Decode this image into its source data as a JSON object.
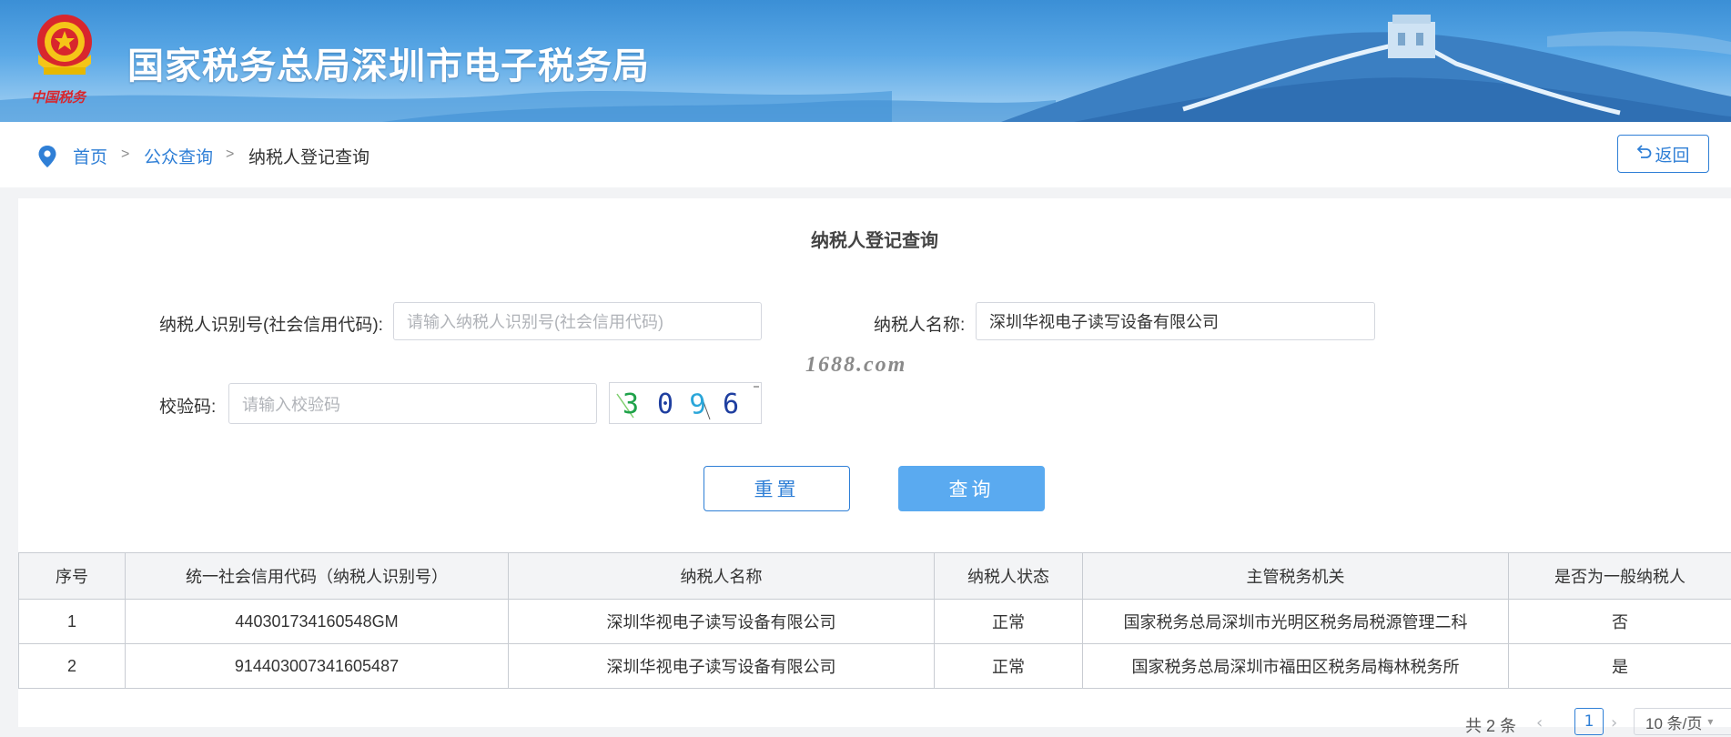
{
  "header": {
    "title": "国家税务总局深圳市电子税务局",
    "emblem_caption": "中国税务"
  },
  "breadcrumb": {
    "items": [
      "首页",
      "公众查询",
      "纳税人登记查询"
    ],
    "separator": ">"
  },
  "back_button": {
    "icon": "return-icon",
    "label": "返回"
  },
  "form": {
    "title": "纳税人登记查询",
    "taxpayer_id": {
      "label": "纳税人识别号(社会信用代码):",
      "placeholder": "请输入纳税人识别号(社会信用代码)",
      "value": ""
    },
    "taxpayer_name": {
      "label": "纳税人名称:",
      "value": "深圳华视电子读写设备有限公司"
    },
    "captcha": {
      "label": "校验码:",
      "placeholder": "请输入校验码",
      "value": "",
      "image_text": "3096"
    },
    "reset_label": "重置",
    "query_label": "查询"
  },
  "watermark": "1688.com",
  "table": {
    "headers": [
      "序号",
      "统一社会信用代码（纳税人识别号）",
      "纳税人名称",
      "纳税人状态",
      "主管税务机关",
      "是否为一般纳税人"
    ],
    "rows": [
      [
        "1",
        "440301734160548GM",
        "深圳华视电子读写设备有限公司",
        "正常",
        "国家税务总局深圳市光明区税务局税源管理二科",
        "否"
      ],
      [
        "2",
        "914403007341605487",
        "深圳华视电子读写设备有限公司",
        "正常",
        "国家税务总局深圳市福田区税务局梅林税务所",
        "是"
      ]
    ]
  },
  "pagination": {
    "total": "共 2 条",
    "current_page": "1",
    "page_size": "10 条/页"
  },
  "colors": {
    "accent": "#2f7fd6",
    "query_button": "#5aaaf0"
  }
}
